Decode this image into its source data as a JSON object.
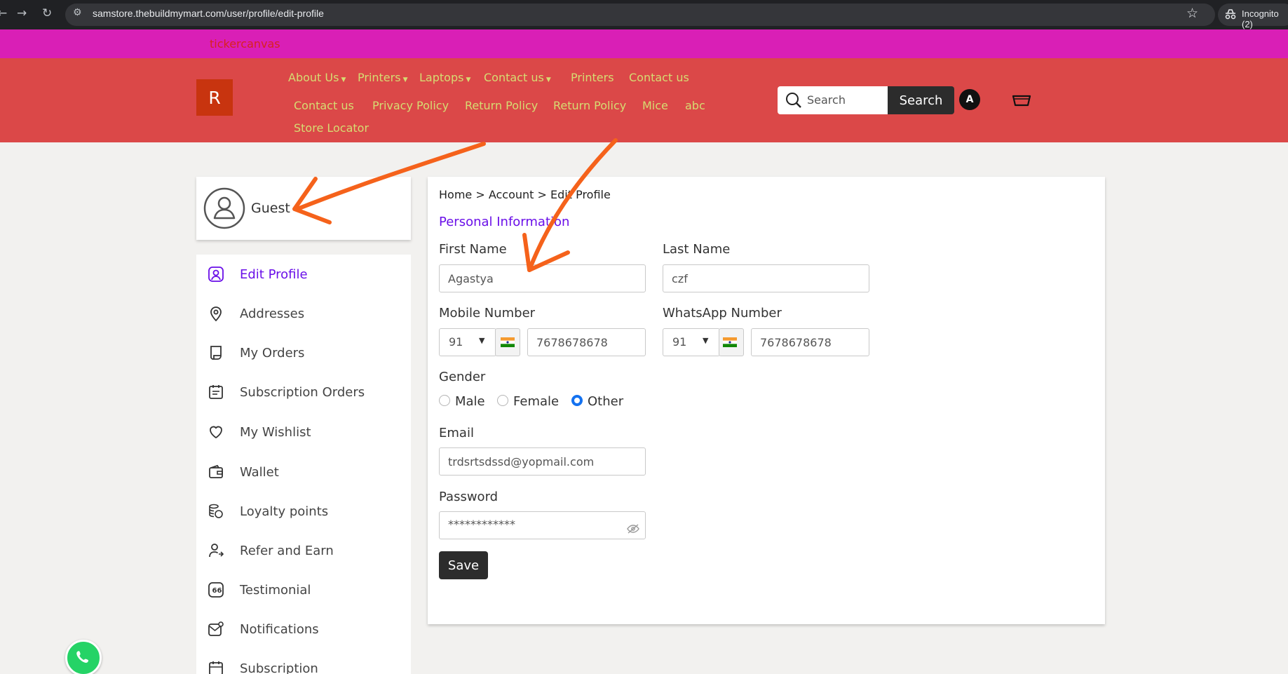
{
  "browser": {
    "url": "samstore.thebuildmymart.com/user/profile/edit-profile",
    "incognito_label": "Incognito (2)"
  },
  "ticker": {
    "text": "tickercanvas"
  },
  "header": {
    "logo_letter": "R",
    "nav_row1": [
      "About Us",
      "Printers",
      "Laptops",
      "Contact us",
      "Printers",
      "Contact us"
    ],
    "nav_row2": [
      "Contact us",
      "Privacy Policy",
      "Return Policy",
      "Return Policy",
      "Mice",
      "abc"
    ],
    "nav_row3": [
      "Store Locator"
    ],
    "search_placeholder": "Search",
    "search_button": "Search",
    "avatar_letter": "A"
  },
  "sidebar": {
    "user_name": "Guest",
    "items": [
      {
        "label": "Edit Profile",
        "icon": "user-square-icon",
        "active": true
      },
      {
        "label": "Addresses",
        "icon": "location-pin-icon"
      },
      {
        "label": "My Orders",
        "icon": "receipt-icon"
      },
      {
        "label": "Subscription Orders",
        "icon": "calendar-note-icon"
      },
      {
        "label": "My Wishlist",
        "icon": "heart-icon"
      },
      {
        "label": "Wallet",
        "icon": "wallet-icon"
      },
      {
        "label": "Loyalty points",
        "icon": "coins-icon"
      },
      {
        "label": "Refer and Earn",
        "icon": "user-share-icon"
      },
      {
        "label": "Testimonial",
        "icon": "quote-icon"
      },
      {
        "label": "Notifications",
        "icon": "mail-notification-icon"
      },
      {
        "label": "Subscription",
        "icon": "calendar-icon"
      }
    ]
  },
  "main": {
    "breadcrumb": "Home > Account > Edit Profile",
    "section_title": "Personal Information",
    "first_name_label": "First Name",
    "first_name_value": "Agastya",
    "last_name_label": "Last Name",
    "last_name_value": "czf",
    "mobile_label": "Mobile Number",
    "mobile_code": "91",
    "mobile_value": "7678678678",
    "whatsapp_label": "WhatsApp Number",
    "whatsapp_code": "91",
    "whatsapp_value": "7678678678",
    "gender_label": "Gender",
    "gender_options": [
      "Male",
      "Female",
      "Other"
    ],
    "gender_selected": "Other",
    "email_label": "Email",
    "email_value": "trdsrtsdssd@yopmail.com",
    "password_label": "Password",
    "password_value": "************",
    "save_label": "Save"
  },
  "colors": {
    "ticker_bg": "#d91fb6",
    "header_bg": "#db4848",
    "nav_text": "#d6dc72",
    "accent": "#6a0fe8",
    "annotation": "#f5621b"
  }
}
